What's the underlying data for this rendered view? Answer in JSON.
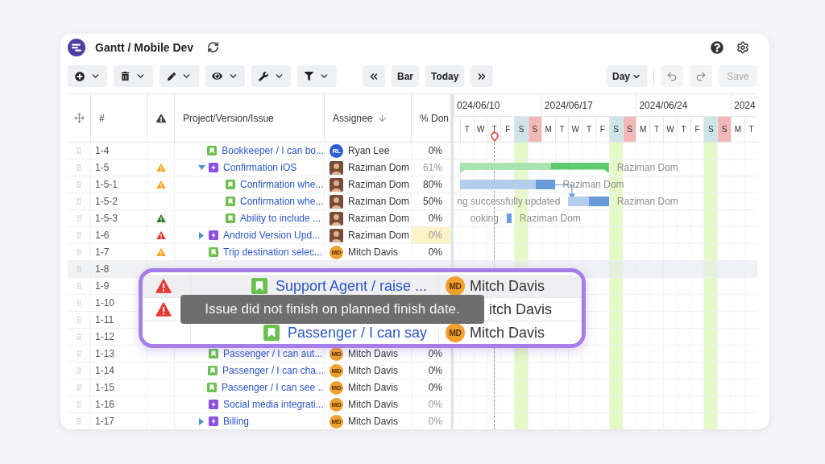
{
  "app": {
    "title": "Gantt / Mobile Dev"
  },
  "toolbar": {
    "menus": [
      {
        "kind": "add"
      },
      {
        "kind": "delete"
      },
      {
        "kind": "edit"
      },
      {
        "kind": "view"
      },
      {
        "kind": "tools"
      },
      {
        "kind": "filter"
      }
    ],
    "navigation": [
      {
        "kind": "back"
      },
      {
        "kind": "text",
        "label": "Bar"
      },
      {
        "kind": "text",
        "label": "Today"
      },
      {
        "kind": "forward"
      }
    ],
    "zoom": {
      "label": "Day"
    },
    "history": [
      {
        "kind": "undo"
      },
      {
        "kind": "redo"
      }
    ],
    "save": {
      "label": "Save",
      "disabled": true
    }
  },
  "table": {
    "columns": [
      {
        "kind": "drag"
      },
      {
        "kind": "text",
        "label": "#"
      },
      {
        "kind": "warning"
      },
      {
        "kind": "text",
        "label": "Project/Version/Issue"
      },
      {
        "kind": "sort",
        "label": "Assignee"
      },
      {
        "kind": "text",
        "label": "% Don"
      }
    ],
    "rows": [
      {
        "number": "1-4",
        "selected": false,
        "kind": "story",
        "title": "Bookkeeper / I can bo...",
        "assignee": {
          "kind": "initials",
          "initials": "RL",
          "name": "Ryan Lee",
          "color": "#2f5fd0"
        },
        "done": "0%"
      },
      {
        "number": "1-5",
        "selected": false,
        "warning": {
          "color": "#f5a623"
        },
        "kind": "epic",
        "expanded": true,
        "title": "Confirmation iOS",
        "assignee": {
          "kind": "photo",
          "name": "Raziman Dom"
        },
        "done": "61%",
        "bar": {
          "level": 0.61,
          "label": "Raziman Dom"
        },
        "children": [
          {
            "number": "1-5-1",
            "selected": false,
            "warning": {
              "color": "#f5a623"
            },
            "kind": "story",
            "title": "Confirmation whe...",
            "assignee": {
              "kind": "photo",
              "name": "Raziman Dom"
            },
            "done": "80%",
            "bar": {
              "level": 0.8,
              "label": "Raziman Dom",
              "link_below": true
            }
          },
          {
            "number": "1-5-2",
            "selected": false,
            "kind": "story",
            "title": "Confirmation whe...",
            "assignee": {
              "kind": "photo",
              "name": "Raziman Dom"
            },
            "done": "50%",
            "bar": {
              "lead": "ng successfully updated",
              "level": 0.5,
              "label": "Raziman Dom"
            }
          },
          {
            "number": "1-5-3",
            "selected": false,
            "warning": {
              "color": "#2e7d32"
            },
            "kind": "story",
            "title": "Ability to include ...",
            "assignee": {
              "kind": "photo",
              "name": "Raziman Dom"
            },
            "done": "0%",
            "bar": {
              "lead": "ooking",
              "level": 0,
              "label": "Raziman Dom"
            }
          }
        ]
      },
      {
        "number": "1-6",
        "selected": false,
        "warning": {
          "color": "#e53935"
        },
        "kind": "epic",
        "expanded": false,
        "title": "Android Version Upd...",
        "assignee": {
          "kind": "photo",
          "name": "Raziman Dom"
        },
        "done": "0%",
        "highlighted": true
      },
      {
        "number": "1-7",
        "selected": false,
        "warning": {
          "color": "#f5a623"
        },
        "kind": "story",
        "title": "Trip destination selec...",
        "assignee": {
          "kind": "initials",
          "initials": "MD",
          "name": "Mitch Davis",
          "color": "#f0a030"
        },
        "done": "0%"
      },
      {
        "number": "1-8",
        "selected": true
      },
      {
        "number": "1-9",
        "selected": false
      },
      {
        "number": "1-10",
        "selected": false
      },
      {
        "number": "1-11",
        "selected": false
      },
      {
        "number": "1-12",
        "selected": false
      },
      {
        "number": "1-13",
        "selected": false,
        "kind": "story",
        "title": "Passenger / I can aut...",
        "assignee": {
          "kind": "initials",
          "initials": "MD",
          "name": "Mitch Davis",
          "color": "#f0a030"
        },
        "done": "0%"
      },
      {
        "number": "1-14",
        "selected": false,
        "kind": "story",
        "title": "Passenger / I can cha...",
        "assignee": {
          "kind": "initials",
          "initials": "MD",
          "name": "Mitch Davis",
          "color": "#f0a030"
        },
        "done": "0%"
      },
      {
        "number": "1-15",
        "selected": false,
        "kind": "story",
        "title": "Passenger / I can see ...",
        "assignee": {
          "kind": "initials",
          "initials": "MD",
          "name": "Mitch Davis",
          "color": "#f0a030"
        },
        "done": "0%"
      },
      {
        "number": "1-16",
        "selected": false,
        "kind": "epic",
        "title": "Social media integrati...",
        "assignee": {
          "kind": "initials",
          "initials": "MD",
          "name": "Mitch Davis",
          "color": "#f0a030"
        },
        "done": "0%"
      },
      {
        "number": "1-17",
        "selected": false,
        "kind": "epic",
        "expanded": false,
        "title": "Billing",
        "assignee": {
          "kind": "initials",
          "initials": "MD",
          "name": "Mitch Davis",
          "color": "#f0a030"
        },
        "done": "0%"
      }
    ]
  },
  "timeline": {
    "weeks": [
      {
        "label": "024/06/10",
        "days": [
          {
            "letter": "T",
            "kind": "weekday"
          },
          {
            "letter": "W",
            "kind": "weekday"
          },
          {
            "letter": "T",
            "kind": "today"
          },
          {
            "letter": "F",
            "kind": "weekday"
          },
          {
            "letter": "S",
            "kind": "saturday"
          },
          {
            "letter": "S",
            "kind": "sunday"
          }
        ]
      },
      {
        "label": "2024/06/17",
        "days": [
          {
            "letter": "M",
            "kind": "weekday"
          },
          {
            "letter": "T",
            "kind": "weekday"
          },
          {
            "letter": "W",
            "kind": "weekday"
          },
          {
            "letter": "T",
            "kind": "weekday"
          },
          {
            "letter": "F",
            "kind": "weekday"
          },
          {
            "letter": "S",
            "kind": "saturday"
          },
          {
            "letter": "S",
            "kind": "sunday"
          }
        ]
      },
      {
        "label": "2024/06/24",
        "days": [
          {
            "letter": "M",
            "kind": "weekday"
          },
          {
            "letter": "T",
            "kind": "weekday"
          },
          {
            "letter": "W",
            "kind": "weekday"
          },
          {
            "letter": "T",
            "kind": "weekday"
          },
          {
            "letter": "F",
            "kind": "weekday"
          },
          {
            "letter": "S",
            "kind": "saturday"
          },
          {
            "letter": "S",
            "kind": "sunday"
          }
        ]
      },
      {
        "label": "2024",
        "days": [
          {
            "letter": "M",
            "kind": "weekday"
          },
          {
            "letter": "T",
            "kind": "weekday"
          }
        ]
      }
    ]
  },
  "magnifier": {
    "rows": [
      {
        "selected": true,
        "warning": {
          "color": "#e53935"
        },
        "kind": "story",
        "title": "Support Agent / raise ...",
        "assignee": {
          "kind": "initials",
          "initials": "MD",
          "name": "Mitch Davis",
          "color": "#f0a030"
        }
      },
      {
        "selected": false,
        "warning": {
          "color": "#e53935"
        },
        "tooltip": "Issue did not finish on planned finish date.",
        "assignee": {
          "name": "itch Davis"
        }
      },
      {
        "selected": false,
        "kind": "story",
        "title": "Passenger / I can say",
        "assignee": {
          "kind": "initials",
          "initials": "MD",
          "name": "Mitch Davis",
          "color": "#f0a030"
        }
      }
    ]
  }
}
